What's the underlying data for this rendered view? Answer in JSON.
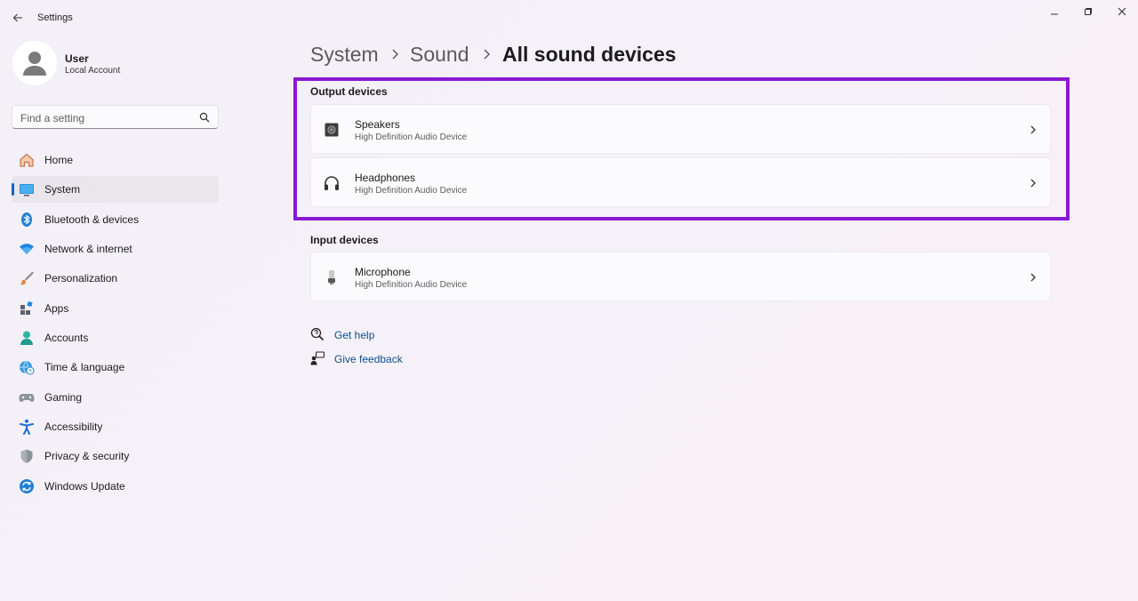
{
  "window": {
    "title": "Settings",
    "back_icon": "back-arrow-icon",
    "controls": [
      "minimize-icon",
      "restore-icon",
      "close-icon"
    ]
  },
  "user": {
    "name": "User",
    "account_type": "Local Account",
    "avatar_icon": "person-icon"
  },
  "search": {
    "placeholder": "Find a setting",
    "icon": "search-icon"
  },
  "nav": {
    "active": "System",
    "items": [
      {
        "label": "Home",
        "icon": "home-icon"
      },
      {
        "label": "System",
        "icon": "monitor-icon"
      },
      {
        "label": "Bluetooth & devices",
        "icon": "bluetooth-icon"
      },
      {
        "label": "Network & internet",
        "icon": "wifi-icon"
      },
      {
        "label": "Personalization",
        "icon": "brush-icon"
      },
      {
        "label": "Apps",
        "icon": "apps-icon"
      },
      {
        "label": "Accounts",
        "icon": "account-icon"
      },
      {
        "label": "Time & language",
        "icon": "globe-clock-icon"
      },
      {
        "label": "Gaming",
        "icon": "gamepad-icon"
      },
      {
        "label": "Accessibility",
        "icon": "accessibility-icon"
      },
      {
        "label": "Privacy & security",
        "icon": "shield-icon"
      },
      {
        "label": "Windows Update",
        "icon": "update-icon"
      }
    ]
  },
  "breadcrumb": {
    "items": [
      "System",
      "Sound"
    ],
    "current": "All sound devices"
  },
  "output_devices": {
    "title": "Output devices",
    "devices": [
      {
        "name": "Speakers",
        "description": "High Definition Audio Device",
        "icon": "speaker-icon"
      },
      {
        "name": "Headphones",
        "description": "High Definition Audio Device",
        "icon": "headphones-icon"
      }
    ]
  },
  "input_devices": {
    "title": "Input devices",
    "devices": [
      {
        "name": "Microphone",
        "description": "High Definition Audio Device",
        "icon": "microphone-icon"
      }
    ]
  },
  "help_links": {
    "get_help": "Get help",
    "give_feedback": "Give feedback"
  },
  "colors": {
    "accent": "#0067c0",
    "highlight_border": "#8b18d1",
    "link": "#0f4e8c"
  }
}
